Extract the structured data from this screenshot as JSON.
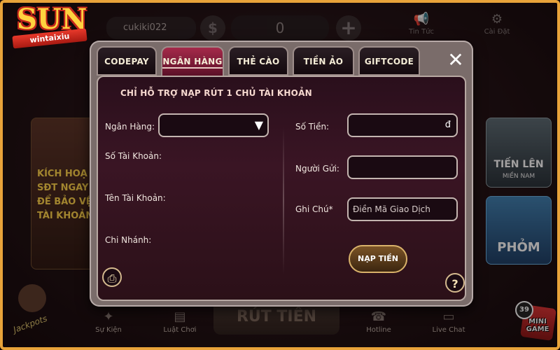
{
  "brand": {
    "logo_main": "SUN",
    "logo_ribbon": "wintaixiu"
  },
  "topbar": {
    "username": "cukiki022",
    "balance": "0",
    "coin_symbol": "$",
    "items": [
      {
        "label": "Tin Tức",
        "icon": "megaphone-icon"
      },
      {
        "label": "Cài Đặt",
        "icon": "gear-icon"
      }
    ]
  },
  "background_cards": {
    "left_lines": [
      "KÍCH HOẠ",
      "SĐT NGAY",
      "ĐỂ BẢO VỆ",
      "TÀI KHOẢN"
    ],
    "right_top_title": "TIẾN LÊN",
    "right_top_sub": "MIỀN NAM",
    "right_bottom_title": "PHỎM",
    "jackpot_text": "Jackpots"
  },
  "bottom_nav": {
    "items": [
      {
        "label": "Sự Kiện",
        "icon": "event-icon"
      },
      {
        "label": "Luật Chơi",
        "icon": "book-icon"
      },
      {
        "label": "Hotline",
        "icon": "phone-icon"
      },
      {
        "label": "Live Chat",
        "icon": "chat-icon"
      }
    ],
    "center_label": "RÚT TIỀN",
    "minigame_count": "39",
    "minigame_label": "MINI GAME"
  },
  "modal": {
    "tabs": [
      {
        "label": "CODEPAY",
        "active": false
      },
      {
        "label": "NGÂN HÀNG",
        "active": true
      },
      {
        "label": "THẺ CÀO",
        "active": false
      },
      {
        "label": "TIỀN ẢO",
        "active": false
      },
      {
        "label": "GIFTCODE",
        "active": false
      }
    ],
    "close_symbol": "✕",
    "notice": "CHỈ HỖ TRỢ NẠP RÚT 1 CHỦ TÀI KHOẢN",
    "left_fields": {
      "bank_label": "Ngân Hàng:",
      "bank_value": "",
      "account_number_label": "Số Tài Khoản:",
      "account_name_label": "Tên Tài Khoản:",
      "branch_label": "Chi Nhánh:"
    },
    "right_fields": {
      "amount_label": "Số Tiền:",
      "amount_currency": "đ",
      "sender_label": "Người Gửi:",
      "sender_value": "",
      "note_label": "Ghi Chú*",
      "note_placeholder": "Điền Mã Giao Dịch"
    },
    "submit_label": "NẠP TIỀN",
    "help_symbol": "?",
    "colors": {
      "active_tab": "#a52a4a",
      "panel_bg": "#2a0f1c",
      "frame": "#e8a33a"
    }
  }
}
